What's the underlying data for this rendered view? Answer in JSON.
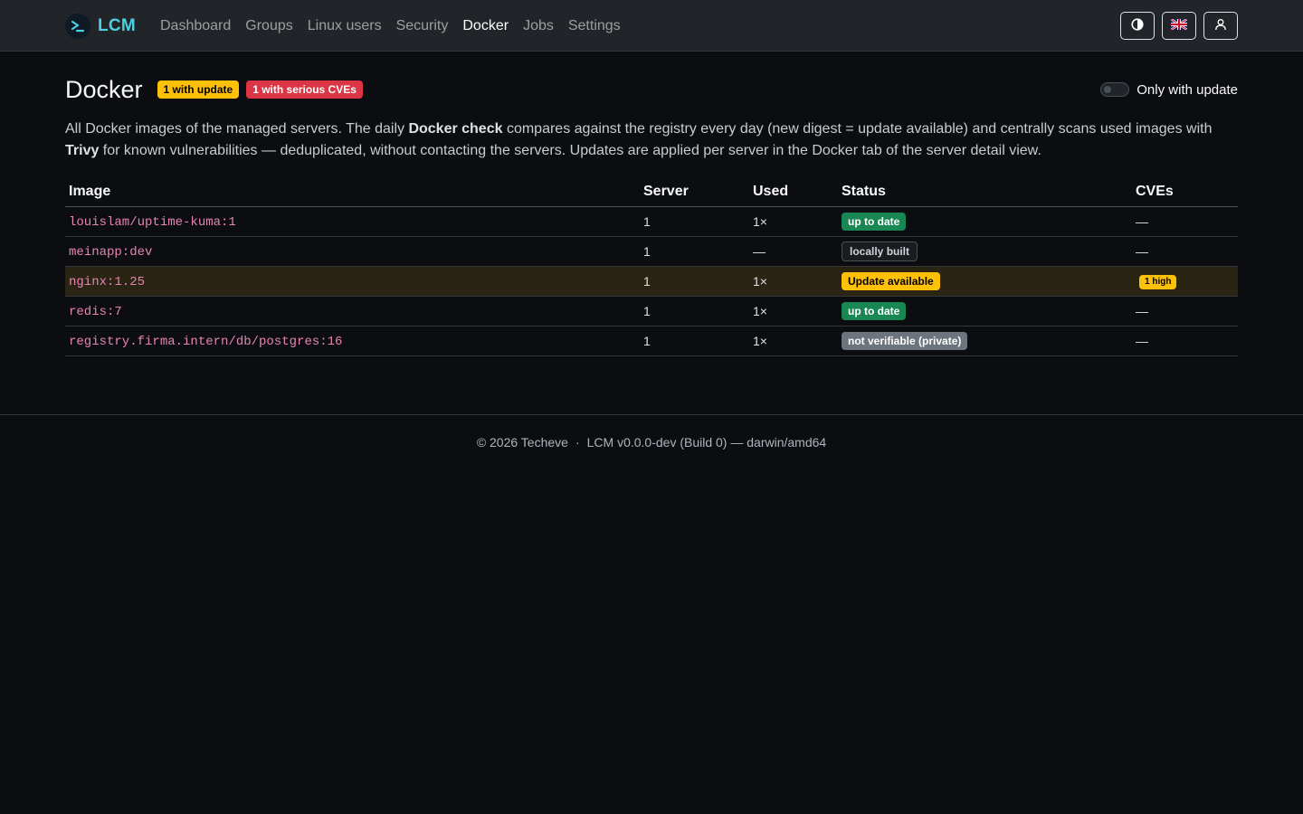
{
  "brand": {
    "name": "LCM",
    "logo_icon": "terminal-chevron-icon",
    "color": "#4dd0e1"
  },
  "nav": {
    "items": [
      {
        "label": "Dashboard",
        "active": false
      },
      {
        "label": "Groups",
        "active": false
      },
      {
        "label": "Linux users",
        "active": false
      },
      {
        "label": "Security",
        "active": false
      },
      {
        "label": "Docker",
        "active": true
      },
      {
        "label": "Jobs",
        "active": false
      },
      {
        "label": "Settings",
        "active": false
      }
    ],
    "right_buttons": [
      "theme-toggle-icon",
      "uk-flag-icon",
      "user-icon"
    ]
  },
  "header": {
    "title": "Docker",
    "badges": [
      {
        "text": "1 with update",
        "variant": "warning"
      },
      {
        "text": "1 with serious CVEs",
        "variant": "danger"
      }
    ],
    "filter_toggle": {
      "label": "Only with update",
      "checked": false
    }
  },
  "description": {
    "part1": "All Docker images of the managed servers. The daily ",
    "bold1": "Docker check",
    "part2": " compares against the registry every day (new digest = update available) and centrally scans used images with ",
    "bold2": "Trivy",
    "part3": " for known vulnerabilities — deduplicated, without contacting the servers. Updates are applied per server in the Docker tab of the server detail view."
  },
  "table": {
    "columns": [
      "Image",
      "Server",
      "Used",
      "Status",
      "CVEs"
    ],
    "rows": [
      {
        "image": "louislam/uptime-kuma:1",
        "server": "1",
        "used": "1×",
        "status": "up to date",
        "status_variant": "success",
        "cves": "—",
        "highlight": false
      },
      {
        "image": "meinapp:dev",
        "server": "1",
        "used": "—",
        "status": "locally built",
        "status_variant": "outline",
        "cves": "—",
        "highlight": false
      },
      {
        "image": "nginx:1.25",
        "server": "1",
        "used": "1×",
        "status": "Update available",
        "status_variant": "warning",
        "cves": "1 high",
        "highlight": true
      },
      {
        "image": "redis:7",
        "server": "1",
        "used": "1×",
        "status": "up to date",
        "status_variant": "success",
        "cves": "—",
        "highlight": false
      },
      {
        "image": "registry.firma.intern/db/postgres:16",
        "server": "1",
        "used": "1×",
        "status": "not verifiable (private)",
        "status_variant": "secondary",
        "cves": "—",
        "highlight": false
      }
    ]
  },
  "footer": {
    "copyright": "© 2026 Techeve",
    "separator": "·",
    "version": "LCM v0.0.0-dev (Build 0) — darwin/amd64"
  }
}
